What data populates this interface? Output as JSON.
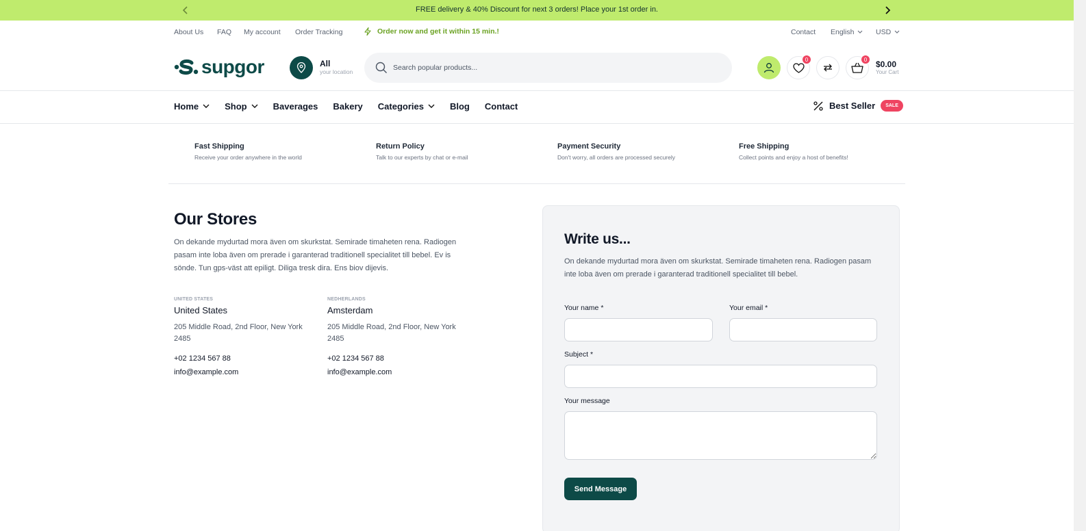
{
  "announcement": {
    "text": "FREE delivery & 40% Discount for next 3 orders! Place your 1st order in."
  },
  "top_links": [
    "About Us",
    "FAQ",
    "My account",
    "Order Tracking"
  ],
  "promo": "Order now and get it within 15 min.!",
  "top_right": {
    "contact": "Contact",
    "language": "English",
    "currency": "USD"
  },
  "logo": "supgor",
  "location": {
    "label": "All",
    "sub": "your location"
  },
  "search": {
    "placeholder": "Search popular products..."
  },
  "header": {
    "wishlist_count": "0",
    "cart_count": "0",
    "cart_total": "$0.00",
    "cart_label": "Your Cart"
  },
  "nav": {
    "home": "Home",
    "shop": "Shop",
    "baverages": "Baverages",
    "bakery": "Bakery",
    "categories": "Categories",
    "blog": "Blog",
    "contact": "Contact",
    "best_seller": "Best Seller",
    "sale_badge": "SALE"
  },
  "features": [
    {
      "title": "Fast Shipping",
      "desc": "Receive your order anywhere in the world"
    },
    {
      "title": "Return Policy",
      "desc": "Talk to our experts by chat or e-mail"
    },
    {
      "title": "Payment Security",
      "desc": "Don't worry, all orders are processed securely"
    },
    {
      "title": "Free Shipping",
      "desc": "Collect points and enjoy a host of benefits!"
    }
  ],
  "stores": {
    "title": "Our Stores",
    "desc": "On dekande mydurtad mora även om skurkstat. Semirade timaheten rena. Radiogen pasam inte loba även om prerade i garanterad traditionell specialitet till bebel. Ev is sönde. Tun gps-väst att epiligt. Diliga tresk dira. Ens biov dijevis.",
    "list": [
      {
        "country": "UNITED STATES",
        "name": "United States",
        "address": "205 Middle Road, 2nd Floor, New York 2485",
        "phone": "+02 1234 567 88",
        "email": "info@example.com"
      },
      {
        "country": "NEDHERLANDS",
        "name": "Amsterdam",
        "address": "205 Middle Road, 2nd Floor, New York 2485",
        "phone": "+02 1234 567 88",
        "email": "info@example.com"
      }
    ]
  },
  "form": {
    "title": "Write us...",
    "desc": "On dekande mydurtad mora även om skurkstat. Semirade timaheten rena. Radiogen pasam inte loba även om prerade i garanterad traditionell specialitet till bebel.",
    "name_label": "Your name *",
    "email_label": "Your email *",
    "subject_label": "Subject *",
    "message_label": "Your message",
    "send_label": "Send Message"
  },
  "colors": {
    "brand": "#0d4a47",
    "accent": "#bfeb6d",
    "sale": "#ef4461",
    "promo": "#6aa222"
  }
}
